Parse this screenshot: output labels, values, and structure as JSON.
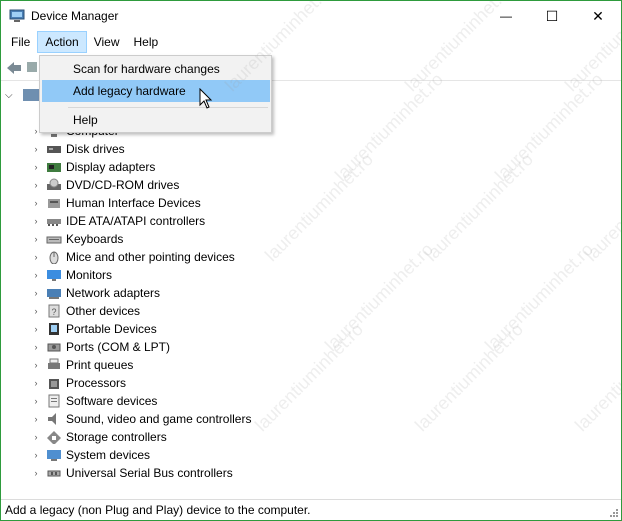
{
  "window": {
    "title": "Device Manager",
    "minimize_glyph": "—",
    "maximize_glyph": "☐",
    "close_glyph": "✕",
    "accent_border": "#2e9b3d"
  },
  "menubar": {
    "items": [
      {
        "label": "File",
        "active": false
      },
      {
        "label": "Action",
        "active": true
      },
      {
        "label": "View",
        "active": false
      },
      {
        "label": "Help",
        "active": false
      }
    ]
  },
  "dropdown": {
    "items": [
      {
        "label": "Scan for hardware changes",
        "hover": false
      },
      {
        "label": "Add legacy hardware",
        "hover": true
      },
      {
        "label": "Help",
        "hover": false
      }
    ],
    "hover_color": "#91c9f7"
  },
  "tree": {
    "root_expanded_glyph": "⌵",
    "collapsed_glyph": "›",
    "items": [
      {
        "label": "Computer",
        "icon": "computer-icon"
      },
      {
        "label": "Disk drives",
        "icon": "disk-drive-icon"
      },
      {
        "label": "Display adapters",
        "icon": "display-adapter-icon"
      },
      {
        "label": "DVD/CD-ROM drives",
        "icon": "dvd-drive-icon"
      },
      {
        "label": "Human Interface Devices",
        "icon": "hid-icon"
      },
      {
        "label": "IDE ATA/ATAPI controllers",
        "icon": "ide-controller-icon"
      },
      {
        "label": "Keyboards",
        "icon": "keyboard-icon"
      },
      {
        "label": "Mice and other pointing devices",
        "icon": "mouse-icon"
      },
      {
        "label": "Monitors",
        "icon": "monitor-icon"
      },
      {
        "label": "Network adapters",
        "icon": "network-adapter-icon"
      },
      {
        "label": "Other devices",
        "icon": "other-devices-icon"
      },
      {
        "label": "Portable Devices",
        "icon": "portable-device-icon"
      },
      {
        "label": "Ports (COM & LPT)",
        "icon": "port-icon"
      },
      {
        "label": "Print queues",
        "icon": "printer-icon"
      },
      {
        "label": "Processors",
        "icon": "processor-icon"
      },
      {
        "label": "Software devices",
        "icon": "software-device-icon"
      },
      {
        "label": "Sound, video and game controllers",
        "icon": "sound-icon"
      },
      {
        "label": "Storage controllers",
        "icon": "storage-controller-icon"
      },
      {
        "label": "System devices",
        "icon": "system-device-icon"
      },
      {
        "label": "Universal Serial Bus controllers",
        "icon": "usb-icon"
      }
    ]
  },
  "statusbar": {
    "text": "Add a legacy (non Plug and Play) device to the computer."
  },
  "watermark": {
    "text": "laurentiuminhet.ro"
  }
}
